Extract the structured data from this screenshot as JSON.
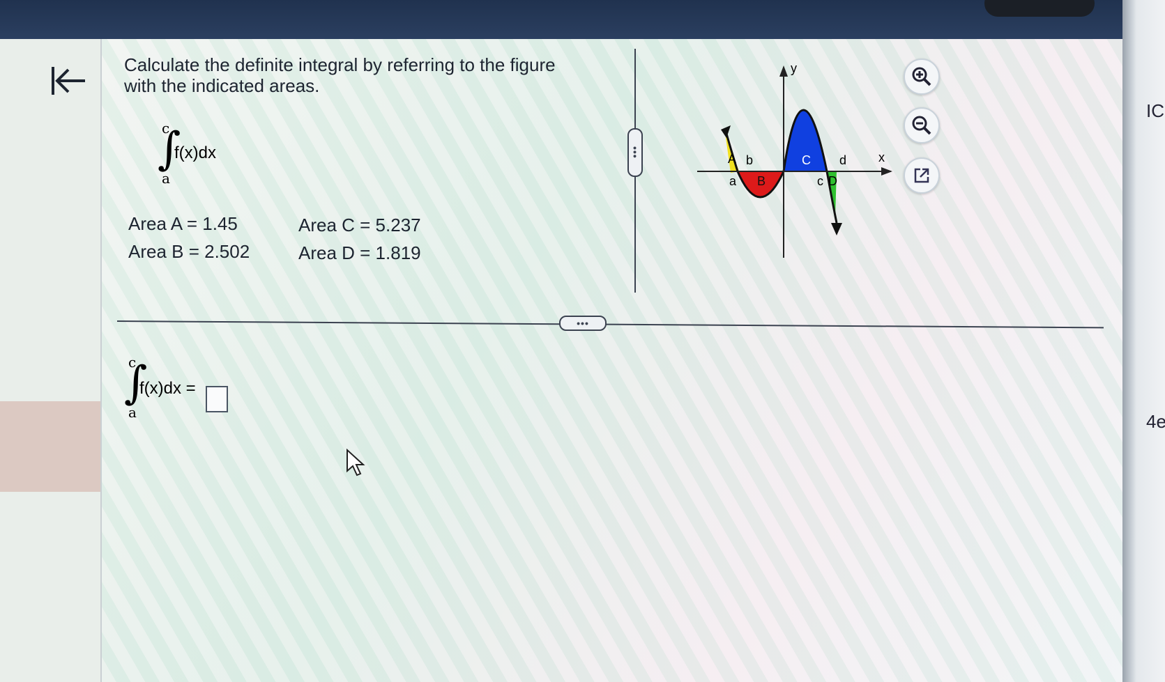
{
  "question": {
    "line1": "Calculate the definite integral by referring to the figure",
    "line2": "with the indicated areas."
  },
  "integral": {
    "lower": "a",
    "upper": "c",
    "integrand": "f(x)dx"
  },
  "areas": [
    {
      "label": "Area A = 1.45"
    },
    {
      "label": "Area B = 2.502"
    },
    {
      "label": "Area C = 5.237"
    },
    {
      "label": "Area D = 1.819"
    }
  ],
  "answer": {
    "integrand": "f(x)dx =",
    "lower": "a",
    "upper": "c",
    "value": ""
  },
  "figure": {
    "axis_x": "x",
    "axis_y": "y",
    "point_labels": [
      "a",
      "b",
      "c",
      "d"
    ],
    "region_labels": [
      "A",
      "B",
      "C",
      "D"
    ],
    "colors": {
      "A": "#f0e020",
      "B": "#dd1a1a",
      "C": "#1040e0",
      "D": "#30c030"
    }
  },
  "toolbar": {
    "zoom_in_icon": "zoom-in-icon",
    "zoom_out_icon": "zoom-out-icon",
    "popout_icon": "external-link-icon"
  },
  "right_strip": {
    "top_text": "IC",
    "bottom_text": "4e"
  }
}
